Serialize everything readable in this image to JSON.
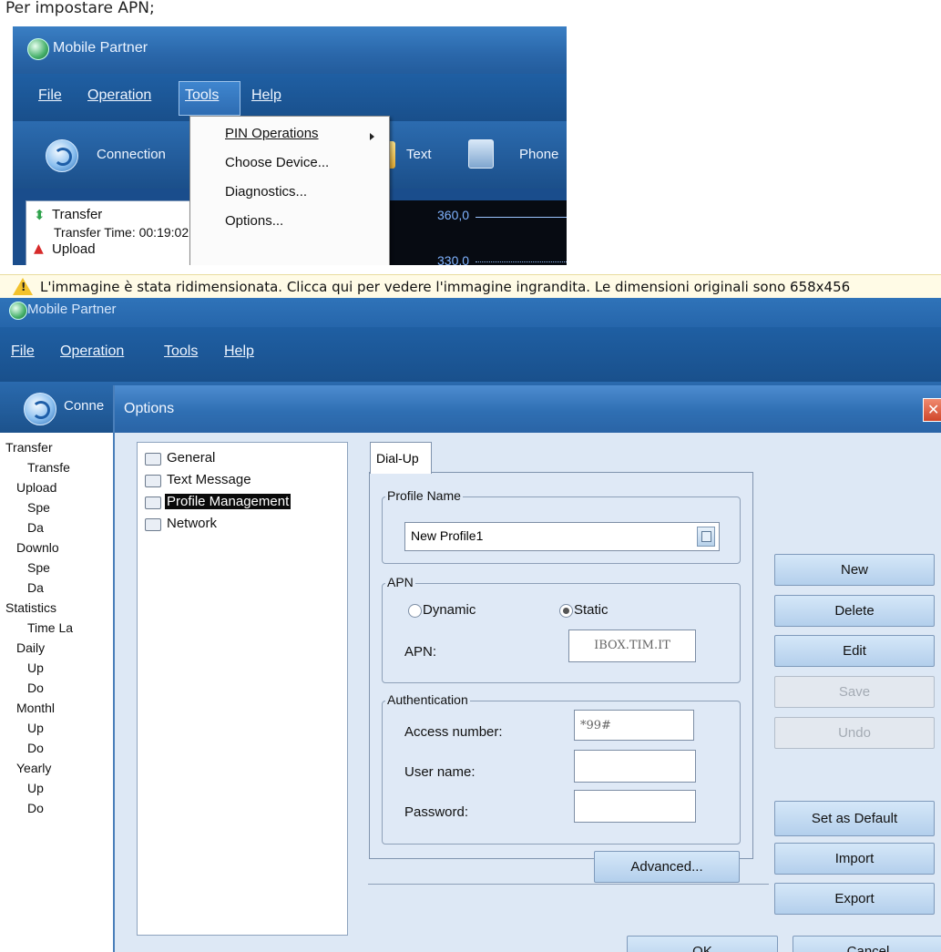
{
  "caption": "Per impostare APN;",
  "screenshot1": {
    "app_title": "Mobile Partner",
    "menu": [
      "File",
      "Operation",
      "Tools",
      "Help"
    ],
    "toolbar": {
      "connection": "Connection",
      "text": "Text",
      "phonebook": "Phone"
    },
    "tools_menu": {
      "items": [
        "PIN Operations",
        "Choose Device...",
        "Diagnostics...",
        "Options..."
      ]
    },
    "tree": {
      "transfer": "Transfer",
      "transfer_time": "Transfer Time: 00:19:02",
      "upload": "Upload"
    },
    "chart_ticks": [
      "360,0",
      "330,0"
    ]
  },
  "warning": {
    "text": "L'immagine è stata ridimensionata. Clicca qui per vedere l'immagine ingrandita. Le dimensioni originali sono 658x456"
  },
  "screenshot2": {
    "app_title": "Mobile Partner",
    "menu": [
      "File",
      "Operation",
      "Tools",
      "Help"
    ],
    "toolbar_connection": "Conne",
    "tree": [
      {
        "label": "Transfer",
        "indent": 0
      },
      {
        "label": "Transfe",
        "indent": 2
      },
      {
        "label": "Upload",
        "indent": 1
      },
      {
        "label": "Spe",
        "indent": 2
      },
      {
        "label": "Da",
        "indent": 2
      },
      {
        "label": "Downlo",
        "indent": 1
      },
      {
        "label": "Spe",
        "indent": 2
      },
      {
        "label": "Da",
        "indent": 2
      },
      {
        "label": "Statistics",
        "indent": 0
      },
      {
        "label": "Time La",
        "indent": 2
      },
      {
        "label": "Daily",
        "indent": 1
      },
      {
        "label": "Up",
        "indent": 2
      },
      {
        "label": "Do",
        "indent": 2
      },
      {
        "label": "Monthl",
        "indent": 1
      },
      {
        "label": "Up",
        "indent": 2
      },
      {
        "label": "Do",
        "indent": 2
      },
      {
        "label": "Yearly",
        "indent": 1
      },
      {
        "label": "Up",
        "indent": 2
      },
      {
        "label": "Do",
        "indent": 2
      }
    ],
    "dialog": {
      "title": "Options",
      "nav": [
        "General",
        "Text Message",
        "Profile Management",
        "Network"
      ],
      "selected_nav": "Profile Management",
      "tab": "Dial-Up",
      "profile_name_legend": "Profile Name",
      "profile_value": "New Profile1",
      "apn_legend": "APN",
      "radio_dynamic": "Dynamic",
      "radio_static": "Static",
      "apn_label": "APN:",
      "apn_value": "IBOX.TIM.IT",
      "auth_legend": "Authentication",
      "access_label": "Access number:",
      "access_value": "*99#",
      "user_label": "User name:",
      "user_value": "",
      "password_label": "Password:",
      "password_value": "",
      "advanced_btn": "Advanced...",
      "buttons": {
        "new": "New",
        "delete": "Delete",
        "edit": "Edit",
        "save": "Save",
        "undo": "Undo",
        "set_default": "Set as Default",
        "import": "Import",
        "export": "Export"
      },
      "ok": "OK",
      "cancel": "Cancel"
    }
  },
  "colors": {
    "title_blue": "#2a67aa",
    "warning_yellow": "#f3c22c",
    "button_blue": "#b3cfec"
  }
}
